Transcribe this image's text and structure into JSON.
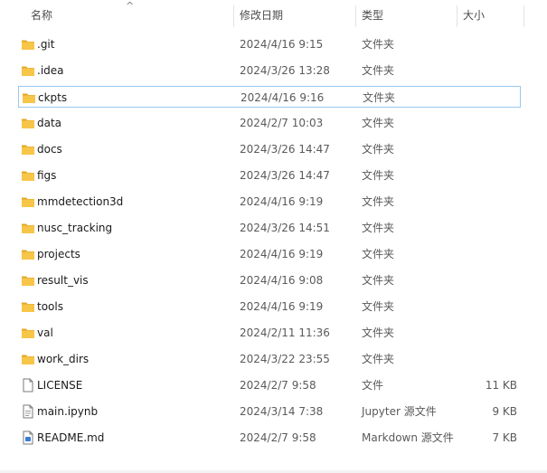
{
  "columns": {
    "name": "名称",
    "modified": "修改日期",
    "type": "类型",
    "size": "大小"
  },
  "sort_indicator": "^",
  "rows": [
    {
      "name": ".git",
      "modified": "2024/4/16 9:15",
      "type": "文件夹",
      "size": "",
      "icon": "folder-icon"
    },
    {
      "name": ".idea",
      "modified": "2024/3/26 13:28",
      "type": "文件夹",
      "size": "",
      "icon": "folder-icon"
    },
    {
      "name": "ckpts",
      "modified": "2024/4/16 9:16",
      "type": "文件夹",
      "size": "",
      "icon": "folder-icon"
    },
    {
      "name": "data",
      "modified": "2024/2/7 10:03",
      "type": "文件夹",
      "size": "",
      "icon": "folder-icon"
    },
    {
      "name": "docs",
      "modified": "2024/3/26 14:47",
      "type": "文件夹",
      "size": "",
      "icon": "folder-icon"
    },
    {
      "name": "figs",
      "modified": "2024/3/26 14:47",
      "type": "文件夹",
      "size": "",
      "icon": "folder-icon"
    },
    {
      "name": "mmdetection3d",
      "modified": "2024/4/16 9:19",
      "type": "文件夹",
      "size": "",
      "icon": "folder-icon"
    },
    {
      "name": "nusc_tracking",
      "modified": "2024/3/26 14:51",
      "type": "文件夹",
      "size": "",
      "icon": "folder-icon"
    },
    {
      "name": "projects",
      "modified": "2024/4/16 9:19",
      "type": "文件夹",
      "size": "",
      "icon": "folder-icon"
    },
    {
      "name": "result_vis",
      "modified": "2024/4/16 9:08",
      "type": "文件夹",
      "size": "",
      "icon": "folder-icon"
    },
    {
      "name": "tools",
      "modified": "2024/4/16 9:19",
      "type": "文件夹",
      "size": "",
      "icon": "folder-icon"
    },
    {
      "name": "val",
      "modified": "2024/2/11 11:36",
      "type": "文件夹",
      "size": "",
      "icon": "folder-icon"
    },
    {
      "name": "work_dirs",
      "modified": "2024/3/22 23:55",
      "type": "文件夹",
      "size": "",
      "icon": "folder-icon"
    },
    {
      "name": "LICENSE",
      "modified": "2024/2/7 9:58",
      "type": "文件",
      "size": "11 KB",
      "icon": "file-icon"
    },
    {
      "name": "main.ipynb",
      "modified": "2024/3/14 7:38",
      "type": "Jupyter 源文件",
      "size": "9 KB",
      "icon": "notebook-file-icon"
    },
    {
      "name": "README.md",
      "modified": "2024/2/7 9:58",
      "type": "Markdown 源文件",
      "size": "7 KB",
      "icon": "markdown-file-icon"
    }
  ],
  "focused_row": 2,
  "colors": {
    "folder": "#f7c548",
    "folder_dark": "#e0a92a",
    "focus_border": "#99c9ef"
  }
}
